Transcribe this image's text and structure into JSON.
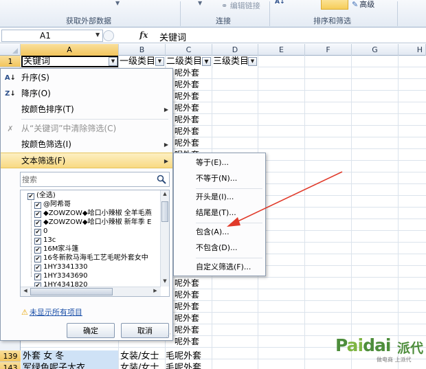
{
  "ribbon": {
    "get_external_data": "获取外部数据",
    "connections": "连接",
    "edit_links": "编辑链接",
    "sort_filter": "排序和筛选",
    "advanced": "高级",
    "sort_az": "A↓"
  },
  "formula_bar": {
    "cell_ref": "A1",
    "fx": "fx",
    "content": "关键词"
  },
  "columns": [
    "A",
    "B",
    "C",
    "D",
    "E",
    "F",
    "G",
    "H"
  ],
  "header_row": {
    "row_number": "1",
    "a": "关键词",
    "b": "一级类目",
    "c": "二级类目",
    "d": "三级类目"
  },
  "column_c_value": "呢外套",
  "bottom_rows": [
    {
      "row": "139",
      "a": "外套 女 冬",
      "b": "女装/女士",
      "c": "毛呢外套"
    },
    {
      "row": "143",
      "a": "军绿色呢子大衣",
      "b": "女装/女士",
      "c": "毛呢外套"
    }
  ],
  "filter_menu": {
    "sort_asc": "升序(S)",
    "sort_desc": "降序(O)",
    "sort_by_color": "按颜色排序(T)",
    "clear_filter": "从“关键词”中清除筛选(C)",
    "filter_by_color": "按颜色筛选(I)",
    "text_filter": "文本筛选(F)",
    "search_placeholder": "搜索",
    "values": [
      "(全选)",
      "@阿希哥",
      "◆ZOWZOW◆哈口小辣椒 全羊毛燕",
      "◆ZOWZOW◆哈口小辣椒 新年季 E",
      "0",
      "13c",
      "16M家斗篷",
      "16冬新款马海毛工艺毛呢外套女中",
      "1HY3341330",
      "1HY3343690",
      "1HY4341820"
    ],
    "show_all": "未显示所有项目",
    "ok": "确定",
    "cancel": "取消"
  },
  "text_filter_submenu": {
    "equals": "等于(E)...",
    "not_equals": "不等于(N)...",
    "begins_with": "开头是(I)...",
    "ends_with": "结尾是(T)...",
    "contains": "包含(A)...",
    "not_contains": "不包含(D)...",
    "custom": "自定义筛选(F)..."
  },
  "watermark": {
    "logo_p": "P",
    "logo_ai": "ai",
    "logo_rest": "dai",
    "chinese": "派代",
    "tagline": "做电商 上派代"
  },
  "colors": {
    "selection_header": "#f2c55d",
    "menu_highlight": "#f8d982",
    "link": "#1a4fa8",
    "arrow": "#e03a2a",
    "cell_selected_bg": "#cfe2f6"
  },
  "icons": {
    "sort_asc": "sort-ascending-icon",
    "sort_desc": "sort-descending-icon",
    "clear_filter": "clear-filter-icon",
    "search": "search-icon",
    "warning": "warning-icon"
  }
}
